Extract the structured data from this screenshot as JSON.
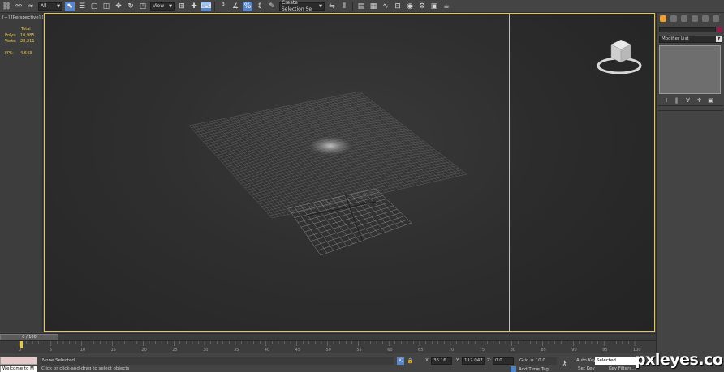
{
  "toolbar": {
    "selection_filter": "All",
    "reference_coord": "View",
    "named_selection_placeholder": "Create Selection Se"
  },
  "viewport": {
    "label": "[+] [Perspective] [Realistic]"
  },
  "stats": {
    "header": "Total",
    "polys_label": "Polys:",
    "polys_value": "10,985",
    "verts_label": "Verts:",
    "verts_value": "28,211",
    "fps_label": "FPS:",
    "fps_value": "4.643"
  },
  "command_panel": {
    "modifier_list_label": "Modifier List"
  },
  "timeline": {
    "frame_counter": "0 / 100",
    "ticks": [
      "0",
      "5",
      "10",
      "15",
      "20",
      "25",
      "30",
      "35",
      "40",
      "45",
      "50",
      "55",
      "60",
      "65",
      "70",
      "75",
      "80",
      "85",
      "90",
      "95",
      "100"
    ]
  },
  "status_bar": {
    "maxscript_text": "Welcome to M",
    "selection_status": "None Selected",
    "prompt": "Click or click-and-drag to select objects",
    "x_label": "X:",
    "x_value": "36.16",
    "y_label": "Y:",
    "y_value": "112.047",
    "z_label": "Z:",
    "z_value": "0.0",
    "grid_label": "Grid = 10.0",
    "add_time_tag": "Add Time Tag",
    "auto_key": "Auto Key",
    "selected_option": "Selected",
    "set_key": "Set Key",
    "key_filters": "Key Filters..."
  },
  "watermark": "pxleyes.com",
  "colors": {
    "viewport_border": "#e6c84b",
    "stat_text": "#e5c84a",
    "object_color": "#8b1f4e",
    "active_button": "#5a86c8"
  }
}
